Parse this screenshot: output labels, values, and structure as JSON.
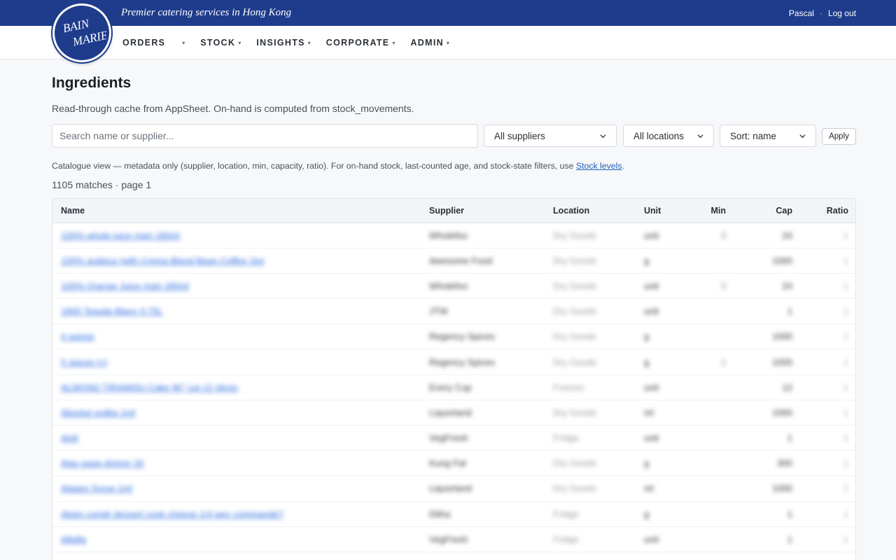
{
  "header": {
    "tagline": "Premier catering services in Hong Kong",
    "user": "Pascal",
    "separator": "·",
    "logout": "Log out",
    "logo_text": [
      "BAIN",
      "MARIE"
    ]
  },
  "nav": {
    "items": [
      {
        "label": "ORDERS"
      },
      {
        "label": "STOCK"
      },
      {
        "label": "INSIGHTS"
      },
      {
        "label": "CORPORATE"
      },
      {
        "label": "ADMIN"
      }
    ],
    "caret": "▾"
  },
  "page": {
    "title": "Ingredients",
    "subtitle": "Read-through cache from AppSheet. On-hand is computed from stock_movements."
  },
  "filters": {
    "search_placeholder": "Search name or supplier...",
    "suppliers": "All suppliers",
    "locations": "All locations",
    "sort": "Sort: name",
    "apply": "Apply"
  },
  "note": {
    "text": "Catalogue view — metadata only (supplier, location, min, capacity, ratio). For on-hand stock, last-counted age, and stock-state filters, use ",
    "link": "Stock levels",
    "end": "."
  },
  "matches": "1105 matches · page 1",
  "table": {
    "columns": [
      "Name",
      "Supplier",
      "Location",
      "Unit",
      "Min",
      "Cap",
      "Ratio"
    ],
    "rows": [
      {
        "name": "100% whole juice mart 180ml",
        "supplier": "Wholefoo",
        "location": "Dry Goods",
        "unit": "unit",
        "min": "3",
        "cap": "24",
        "ratio": "1"
      },
      {
        "name": "100% arabica (with Crema Blend Bean Coffee 1kg",
        "supplier": "Awesome Food",
        "location": "Dry Goods",
        "unit": "g",
        "min": "",
        "cap": "1000",
        "ratio": "1"
      },
      {
        "name": "100% Orange Juice mart 180ml",
        "supplier": "Wholefoo",
        "location": "Dry Goods",
        "unit": "unit",
        "min": "3",
        "cap": "24",
        "ratio": "1"
      },
      {
        "name": "1800 Tequila Blanc 0.75L",
        "supplier": "JTW",
        "location": "Dry Goods",
        "unit": "unit",
        "min": "",
        "cap": "1",
        "ratio": "1"
      },
      {
        "name": "4 spices",
        "supplier": "Regency Spices",
        "location": "Dry Goods",
        "unit": "g",
        "min": "",
        "cap": "1000",
        "ratio": "1"
      },
      {
        "name": "5 spices (c)",
        "supplier": "Regency Spices",
        "location": "Dry Goods",
        "unit": "g",
        "min": "1",
        "cap": "1000",
        "ratio": "1"
      },
      {
        "name": "ALMOND TIRAMISU Cake 90\" cut 12 slices",
        "supplier": "Every Cup",
        "location": "Freezer",
        "unit": "unit",
        "min": "",
        "cap": "12",
        "ratio": "1"
      },
      {
        "name": "Absolut vodka 1ml",
        "supplier": "Liquorland",
        "location": "Dry Goods",
        "unit": "ml",
        "min": "",
        "cap": "1000",
        "ratio": "1"
      },
      {
        "name": "Aioli",
        "supplier": "VegFresh",
        "location": "Fridge",
        "unit": "unit",
        "min": "",
        "cap": "1",
        "ratio": "1"
      },
      {
        "name": "Alas saga shrimp 1K",
        "supplier": "Kung Fat",
        "location": "Dry Goods",
        "unit": "g",
        "min": "",
        "cap": "300",
        "ratio": "1"
      },
      {
        "name": "Algaes Syrup 1ml",
        "supplier": "Liquorland",
        "location": "Dry Goods",
        "unit": "ml",
        "min": "",
        "cap": "1000",
        "ratio": "1"
      },
      {
        "name": "Alpes comté dessert cook cheese 1/4 wey commande?",
        "supplier": "Ditha",
        "location": "Fridge",
        "unit": "g",
        "min": "",
        "cap": "1",
        "ratio": "1"
      },
      {
        "name": "Alfalfa",
        "supplier": "VegFresh",
        "location": "Fridge",
        "unit": "unit",
        "min": "",
        "cap": "1",
        "ratio": "1"
      }
    ]
  }
}
